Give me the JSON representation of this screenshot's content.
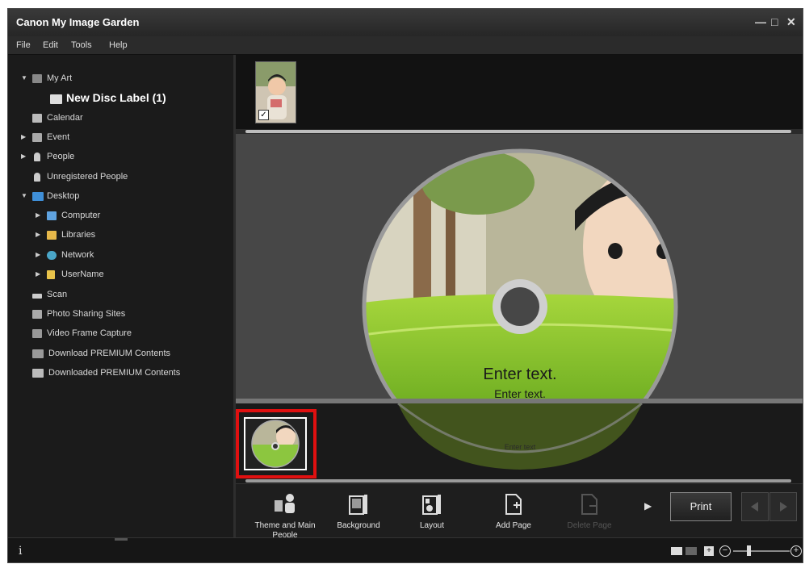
{
  "window": {
    "title": "Canon My Image Garden"
  },
  "menu": {
    "file": "File",
    "edit": "Edit",
    "tools": "Tools",
    "help": "Help"
  },
  "sidebar": {
    "items": [
      {
        "label": "My Art",
        "icon": "my-art-icon"
      },
      {
        "label": "New Disc Label (1)",
        "icon": "disc-label-icon"
      },
      {
        "label": "Calendar",
        "icon": "calendar-icon"
      },
      {
        "label": "Event",
        "icon": "event-icon"
      },
      {
        "label": "People",
        "icon": "people-icon"
      },
      {
        "label": "Unregistered People",
        "icon": "unregistered-people-icon"
      },
      {
        "label": "Desktop",
        "icon": "desktop-icon"
      },
      {
        "label": "Computer",
        "icon": "computer-icon"
      },
      {
        "label": "Libraries",
        "icon": "libraries-icon"
      },
      {
        "label": "Network",
        "icon": "network-icon"
      },
      {
        "label": "UserName",
        "icon": "user-folder-icon"
      },
      {
        "label": "Scan",
        "icon": "scan-icon"
      },
      {
        "label": "Photo Sharing Sites",
        "icon": "photo-sharing-icon"
      },
      {
        "label": "Video Frame Capture",
        "icon": "video-frame-icon"
      },
      {
        "label": "Download PREMIUM Contents",
        "icon": "download-icon"
      },
      {
        "label": "Downloaded PREMIUM Contents",
        "icon": "folder-icon"
      }
    ]
  },
  "disc": {
    "title_text": "Enter text.",
    "subtitle_text": "Enter text.",
    "reflection_text": "Enter text"
  },
  "toolbar": {
    "theme": "Theme and Main People",
    "background": "Background",
    "layout": "Layout",
    "add_page": "Add Page",
    "delete_page": "Delete Page",
    "print": "Print"
  },
  "status": {
    "info": "i"
  },
  "colors": {
    "accent_green": "#8cc63f",
    "highlight_red": "#e01010",
    "disc_ring": "#9a9a9a"
  }
}
